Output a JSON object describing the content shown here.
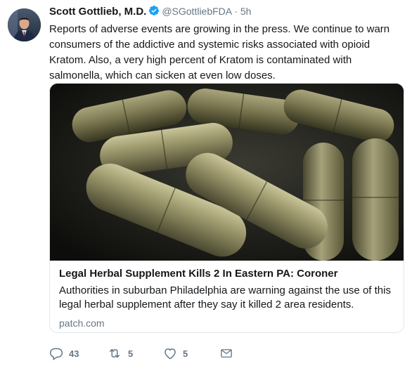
{
  "tweet": {
    "author_name": "Scott Gottlieb, M.D.",
    "handle": "@SGottliebFDA",
    "separator": "·",
    "time": "5h",
    "text": "Reports of adverse events are growing in the press. We continue to warn consumers of the addictive and systemic risks associated with opioid Kratom. Also, a very high percent of Kratom is contaminated with salmonella, which can sicken at even low doses."
  },
  "card": {
    "title": "Legal Herbal Supplement Kills 2 In Eastern PA: Coroner",
    "description": "Authorities in suburban Philadelphia are warning against the use of this legal herbal supplement after they say it killed 2 area residents.",
    "domain": "patch.com"
  },
  "actions": {
    "reply_count": "43",
    "retweet_count": "5",
    "like_count": "5"
  },
  "colors": {
    "text": "#14171a",
    "secondary": "#657786",
    "verified": "#1da1f2",
    "border": "#e1e8ed"
  },
  "icons": [
    "verified-badge-icon",
    "reply-icon",
    "retweet-icon",
    "like-icon",
    "direct-message-icon"
  ]
}
